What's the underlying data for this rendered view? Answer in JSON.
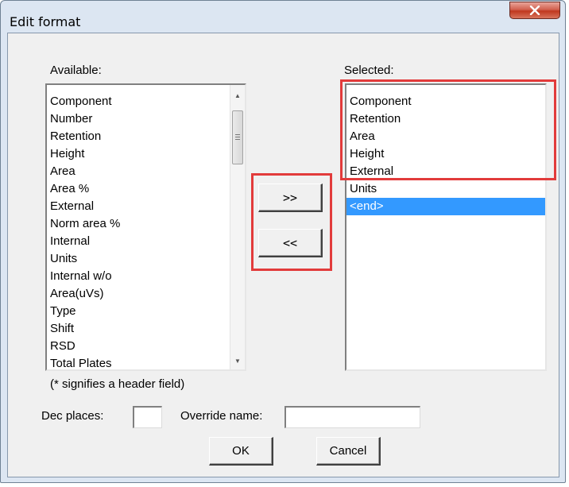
{
  "window": {
    "title": "Edit format",
    "close_label": "X"
  },
  "available": {
    "label": "Available:",
    "items": [
      "Component",
      "Number",
      "Retention",
      "Height",
      "Area",
      "Area %",
      "External",
      "Norm area %",
      "Internal",
      "Units",
      "Internal w/o",
      "Area(uVs)",
      "Type",
      "Shift",
      "RSD",
      "Total Plates"
    ]
  },
  "selected": {
    "label": "Selected:",
    "items": [
      "Component",
      "Retention",
      "Area",
      "Height",
      "External",
      "Units",
      "<end>"
    ],
    "selected_index": 6
  },
  "move": {
    "add_label": ">>",
    "remove_label": "<<"
  },
  "note": "(* signifies a header field)",
  "dec_places": {
    "label": "Dec places:",
    "value": ""
  },
  "override_name": {
    "label": "Override name:",
    "value": ""
  },
  "buttons": {
    "ok": "OK",
    "cancel": "Cancel"
  },
  "colors": {
    "highlight": "#e23b3b",
    "selection": "#3399ff",
    "close": "#c0381f"
  }
}
